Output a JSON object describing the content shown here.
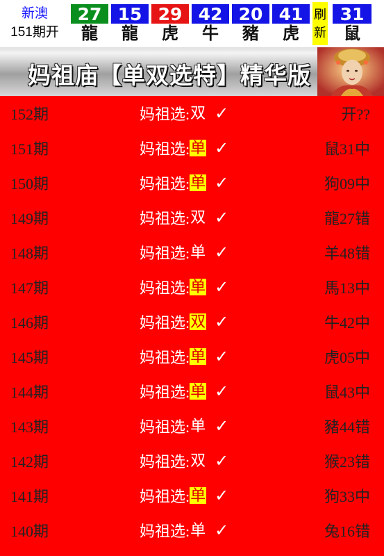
{
  "header": {
    "region": "新澳",
    "issue": "151期开",
    "balls": [
      {
        "number": "27",
        "zodiac": "龍",
        "color": "#0a8f1f"
      },
      {
        "number": "15",
        "zodiac": "龍",
        "color": "#1414e6"
      },
      {
        "number": "29",
        "zodiac": "虎",
        "color": "#e61414"
      },
      {
        "number": "42",
        "zodiac": "牛",
        "color": "#1414e6"
      },
      {
        "number": "20",
        "zodiac": "豬",
        "color": "#1414e6"
      },
      {
        "number": "41",
        "zodiac": "虎",
        "color": "#1414e6"
      }
    ],
    "refresh_label_1": "刷",
    "refresh_label_2": "新",
    "special": {
      "number": "31",
      "zodiac": "鼠",
      "color": "#1414e6"
    }
  },
  "banner": {
    "title": "妈祖庙【单双选特】精华版"
  },
  "prefix": "妈祖选:",
  "check_mark": "✓",
  "rows": [
    {
      "period": "152期",
      "value": "双",
      "highlight": false,
      "result": "开??"
    },
    {
      "period": "151期",
      "value": "单",
      "highlight": true,
      "result": "鼠31中"
    },
    {
      "period": "150期",
      "value": "单",
      "highlight": true,
      "result": "狗09中"
    },
    {
      "period": "149期",
      "value": "双",
      "highlight": false,
      "result": "龍27错"
    },
    {
      "period": "148期",
      "value": "单",
      "highlight": false,
      "result": "羊48错"
    },
    {
      "period": "147期",
      "value": "单",
      "highlight": true,
      "result": "馬13中"
    },
    {
      "period": "146期",
      "value": "双",
      "highlight": true,
      "result": "牛42中"
    },
    {
      "period": "145期",
      "value": "单",
      "highlight": true,
      "result": "虎05中"
    },
    {
      "period": "144期",
      "value": "单",
      "highlight": true,
      "result": "鼠43中"
    },
    {
      "period": "143期",
      "value": "单",
      "highlight": false,
      "result": "豬44错"
    },
    {
      "period": "142期",
      "value": "双",
      "highlight": false,
      "result": "猴23错"
    },
    {
      "period": "141期",
      "value": "单",
      "highlight": true,
      "result": "狗33中"
    },
    {
      "period": "140期",
      "value": "单",
      "highlight": false,
      "result": "兔16错"
    }
  ]
}
